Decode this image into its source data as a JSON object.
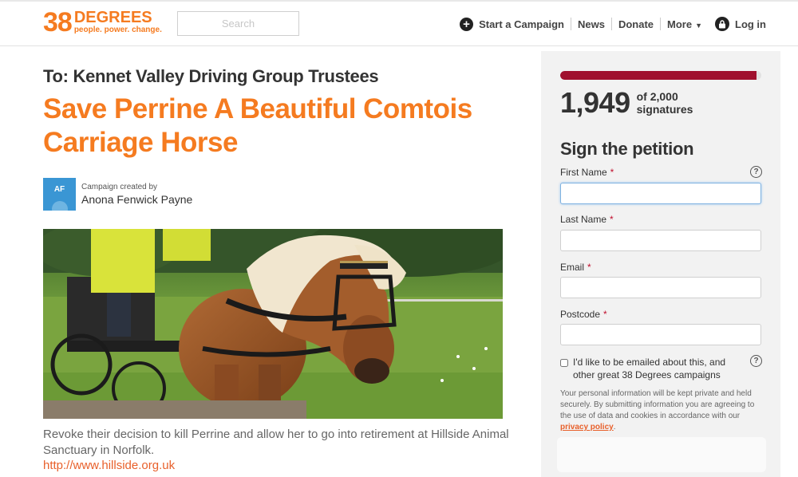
{
  "header": {
    "logo_number": "38",
    "logo_word": "DEGREES",
    "logo_tagline": "people. power. change.",
    "search_placeholder": "Search",
    "nav": {
      "start_campaign": "Start a Campaign",
      "news": "News",
      "donate": "Donate",
      "more": "More",
      "login": "Log in"
    }
  },
  "petition": {
    "recipient": "To: Kennet Valley Driving Group Trustees",
    "title": "Save Perrine A Beautiful Comtois Carriage Horse",
    "creator_label": "Campaign created by",
    "creator_name": "Anona Fenwick Payne",
    "creator_initials": "AF",
    "description": "Revoke their decision to kill Perrine and allow her to go into retirement at Hillside Animal Sanctuary in Norfolk.",
    "link": "http://www.hillside.org.uk"
  },
  "sidebar": {
    "signatures": "1,949",
    "goal_text": "of 2,000 signatures",
    "goal_line1": "of 2,000",
    "goal_line2": "signatures",
    "progress_fraction": 0.9745,
    "heading": "Sign the petition",
    "fields": {
      "first_name": "First Name",
      "last_name": "Last Name",
      "email": "Email",
      "postcode": "Postcode"
    },
    "required_mark": "*",
    "optin_text": "I'd like to be emailed about this, and other great 38 Degrees campaigns",
    "privacy_text": "Your personal information will be kept private and held securely. By submitting information you are agreeing to the use of data and cookies in accordance with our",
    "privacy_link": "privacy policy",
    "help_glyph": "?"
  },
  "colors": {
    "brand_orange": "#f57b20",
    "progress_red": "#a0102e",
    "link_orange": "#e8602b"
  }
}
